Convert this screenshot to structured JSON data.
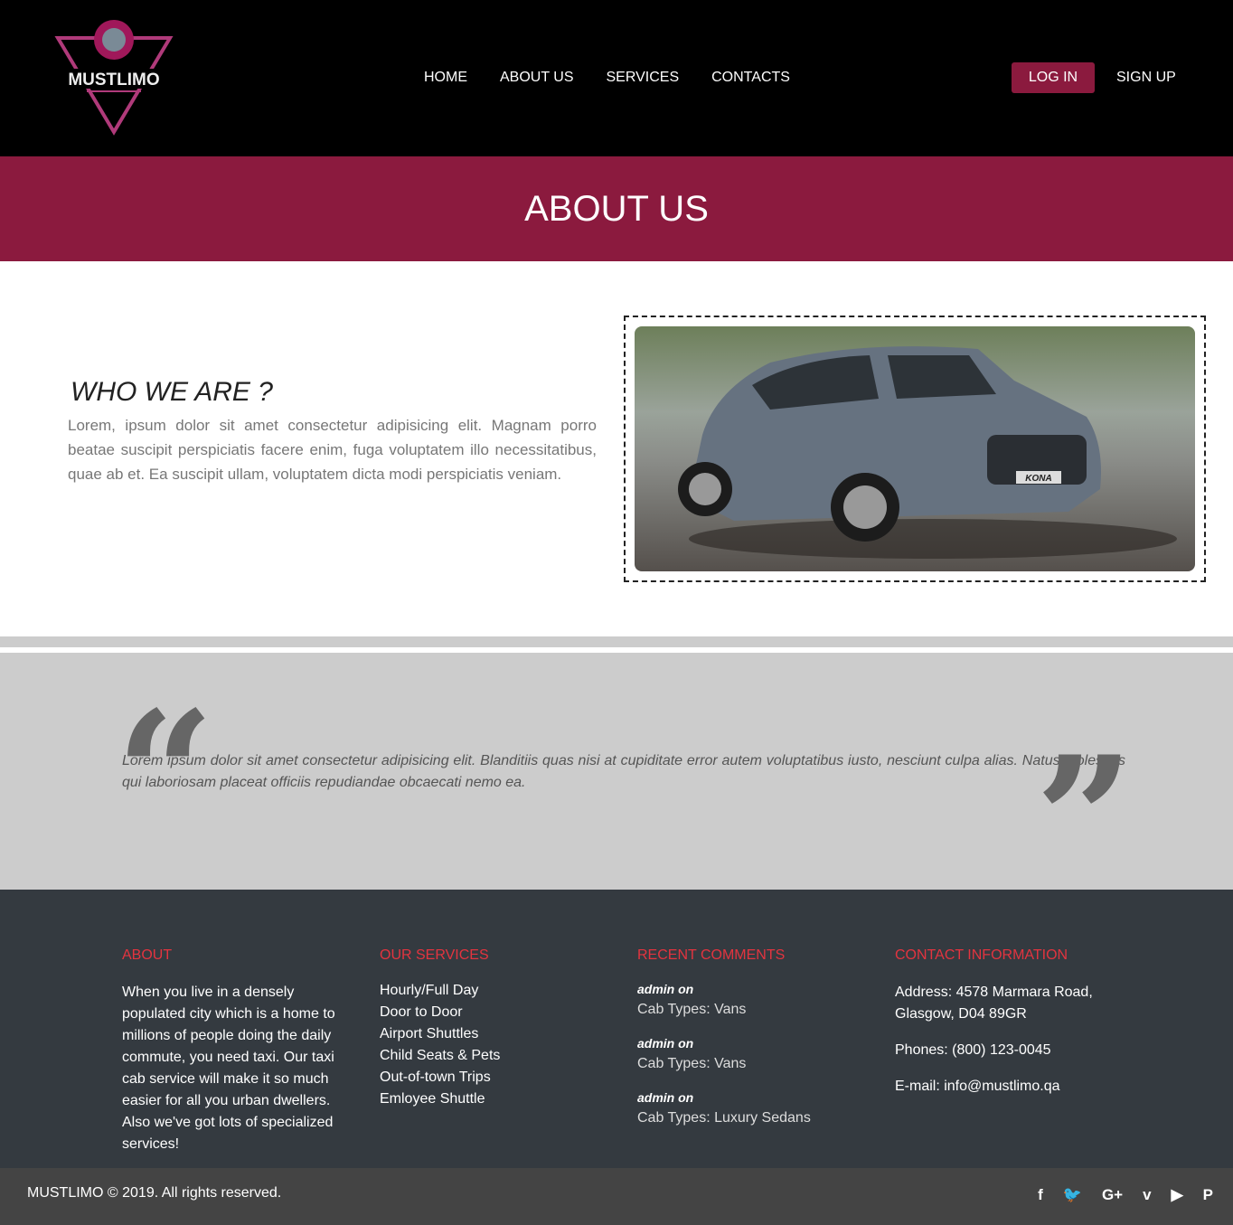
{
  "brand": "MUSTLIMO",
  "nav": [
    "HOME",
    "ABOUT US",
    "SERVICES",
    "CONTACTS"
  ],
  "auth": {
    "login": "LOG IN",
    "signup": "SIGN UP"
  },
  "banner": "ABOUT US",
  "about": {
    "title": "WHO WE ARE ?",
    "text": "Lorem, ipsum dolor sit amet consectetur adipisicing elit. Magnam porro beatae suscipit perspiciatis facere enim, fuga voluptatem illo necessitatibus, quae ab et. Ea suscipit ullam, voluptatem dicta modi perspiciatis veniam.",
    "image_plate": "KONA"
  },
  "quote": "Lorem ipsum dolor sit amet consectetur adipisicing elit. Blanditiis quas nisi at cupiditate error autem voluptatibus iusto, nesciunt culpa alias. Natus molestias qui laboriosam placeat officiis repudiandae obcaecati nemo ea.",
  "footer": {
    "about": {
      "title": "ABOUT",
      "text": "When you live in a densely populated city which is a home to millions of people doing the daily commute, you need taxi. Our taxi cab service will make it so much easier for all you urban dwellers. Also we've got lots of specialized services!"
    },
    "services": {
      "title": "OUR SERVICES",
      "items": [
        "Hourly/Full Day",
        "Door to Door",
        "Airport Shuttles",
        "Child Seats & Pets",
        "Out-of-town Trips",
        "Emloyee Shuttle"
      ]
    },
    "comments": {
      "title": "RECENT COMMENTS",
      "items": [
        {
          "author": "admin on",
          "text": "Cab Types: Vans"
        },
        {
          "author": "admin on",
          "text": "Cab Types: Vans"
        },
        {
          "author": "admin on",
          "text": "Cab Types: Luxury Sedans"
        }
      ]
    },
    "contact": {
      "title": "CONTACT INFORMATION",
      "address": "Address: 4578 Marmara Road, Glasgow, D04 89GR",
      "phone": "Phones: (800) 123-0045",
      "email": "E-mail: info@mustlimo.qa"
    }
  },
  "copyright": "MUSTLIMO © 2019. All rights reserved.",
  "social": [
    "f",
    "🐦",
    "G+",
    "v",
    "▶",
    "P"
  ]
}
